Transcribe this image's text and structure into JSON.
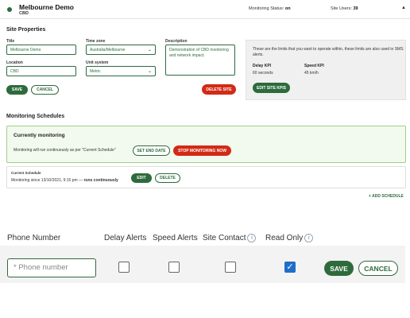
{
  "header": {
    "site_name": "Melbourne Demo",
    "site_code": "CBD",
    "status_label": "Monitoring Status:",
    "status_value": "on",
    "users_label": "Site Users:",
    "users_value": "39"
  },
  "site_properties": {
    "section_title": "Site Properties",
    "title_label": "Title",
    "title_value": "Melbourne Demo",
    "timezone_label": "Time zone",
    "timezone_value": "Australia/Melbourne",
    "description_label": "Description",
    "description_value": "Demonstration of CBD monitoring and network impact.",
    "location_label": "Location",
    "location_value": "CBD",
    "unit_label": "Unit system",
    "unit_value": "Metric",
    "save_label": "SAVE",
    "cancel_label": "CANCEL",
    "delete_label": "DELETE SITE"
  },
  "kpi": {
    "info": "These are the limits that you want to operate within, these limits are also used in SMS alerts.",
    "delay_label": "Delay KPI",
    "delay_value": "60 seconds",
    "speed_label": "Speed KPI",
    "speed_value": "45 km/h",
    "edit_label": "EDIT SITE KPIS"
  },
  "schedules": {
    "section_title": "Monitoring Schedules",
    "current_title": "Currently monitoring",
    "current_text": "Monitoring will run continuously as per \"Current Schedule\"",
    "set_end_label": "SET END DATE",
    "stop_label": "STOP MONITORING NOW",
    "schedule_label": "Current Schedule",
    "schedule_since": "Monitoring since 13/10/2021, 9:15 pm — ",
    "schedule_mode": "runs continuously",
    "edit_label": "EDIT",
    "delete_label": "DELETE",
    "add_label": "+ ADD SCHEDULE"
  },
  "permissions": {
    "columns": {
      "phone": "Phone Number",
      "delay": "Delay Alerts",
      "speed": "Speed Alerts",
      "contact": "Site Contact",
      "readonly": "Read Only"
    },
    "info_icon_glyph": "i",
    "phone_placeholder": "* Phone number",
    "row": {
      "delay_alerts": false,
      "speed_alerts": false,
      "site_contact": false,
      "read_only": true
    },
    "save_label": "SAVE",
    "cancel_label": "CANCEL"
  },
  "colors": {
    "brand_green": "#2e6b3c",
    "danger_red": "#d22a16",
    "checkbox_blue": "#1f6ec9"
  },
  "icons": {
    "status_dot": "status-dot-icon",
    "collapse": "chevron-up-icon",
    "select": "chevron-down-icon",
    "info": "info-icon",
    "check": "checkmark-icon"
  }
}
